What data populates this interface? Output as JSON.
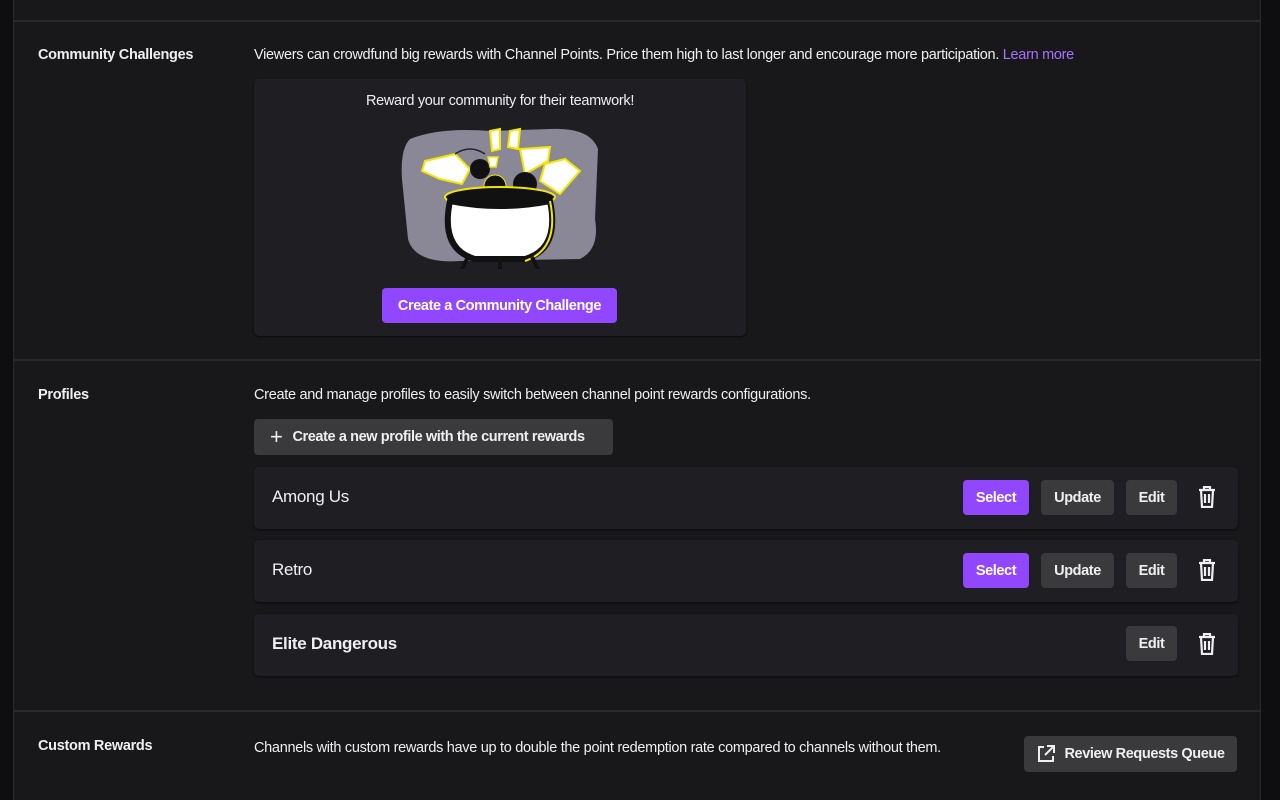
{
  "community_challenges": {
    "title": "Community Challenges",
    "description": "Viewers can crowdfund big rewards with Channel Points. Price them high to last longer and encourage more participation.",
    "learn_more": "Learn more",
    "card_heading": "Reward your community for their teamwork!",
    "create_button": "Create a Community Challenge",
    "illustration": "cauldron-illustration"
  },
  "profiles": {
    "title": "Profiles",
    "description": "Create and manage profiles to easily switch between channel point rewards configurations.",
    "new_profile_button": "Create a new profile with the current rewards",
    "items": [
      {
        "name": "Among Us",
        "active": false,
        "select": "Select",
        "update": "Update",
        "edit": "Edit"
      },
      {
        "name": "Retro",
        "active": false,
        "select": "Select",
        "update": "Update",
        "edit": "Edit"
      },
      {
        "name": "Elite Dangerous",
        "active": true,
        "edit": "Edit"
      }
    ]
  },
  "custom_rewards": {
    "title": "Custom Rewards",
    "description": "Channels with custom rewards have up to double the point redemption rate compared to channels without them.",
    "review_button": "Review Requests Queue"
  },
  "colors": {
    "accent": "#9147ff",
    "link": "#a970ff",
    "background": "#18181b",
    "card": "#1f1f23"
  }
}
